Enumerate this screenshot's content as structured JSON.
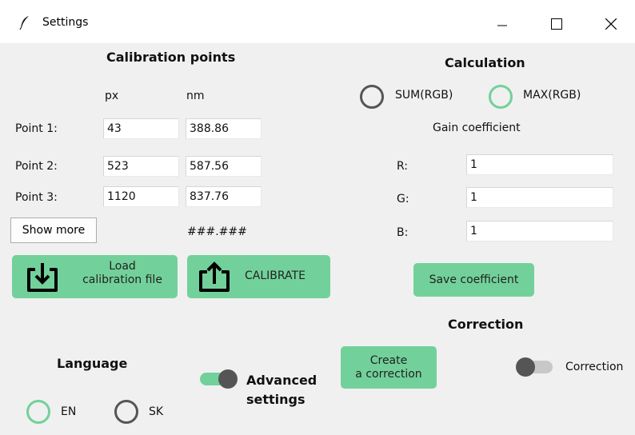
{
  "window": {
    "title": "Settings"
  },
  "calibration": {
    "heading": "Calibration points",
    "col_px": "px",
    "col_nm": "nm",
    "points": [
      {
        "label": "Point  1:",
        "px": "43",
        "nm": "388.86"
      },
      {
        "label": "Point  2:",
        "px": "523",
        "nm": "587.56"
      },
      {
        "label": "Point  3:",
        "px": "1120",
        "nm": "837.76"
      }
    ],
    "show_more": "Show more",
    "format_hint": "###.###",
    "load_line1": "Load",
    "load_line2": "calibration file",
    "calibrate": "CALIBRATE"
  },
  "calculation": {
    "heading": "Calculation",
    "option_sum": "SUM(RGB)",
    "option_max": "MAX(RGB)",
    "selected": "MAX(RGB)",
    "gain_heading": "Gain coefficient",
    "gains": [
      {
        "label": "R:",
        "value": "1"
      },
      {
        "label": "G:",
        "value": "1"
      },
      {
        "label": "B:",
        "value": "1"
      }
    ],
    "save": "Save coefficient"
  },
  "correction": {
    "heading": "Correction",
    "create_line1": "Create",
    "create_line2": "a correction",
    "toggle_label": "Correction",
    "toggle_on": false
  },
  "advanced": {
    "line1": "Advanced",
    "line2": "settings",
    "toggle_on": true
  },
  "language": {
    "heading": "Language",
    "option_en": "EN",
    "option_sk": "SK",
    "selected": "EN"
  },
  "colors": {
    "accent_green": "#72d19a",
    "radio_off": "#555555",
    "toggle_knob": "#555555"
  }
}
